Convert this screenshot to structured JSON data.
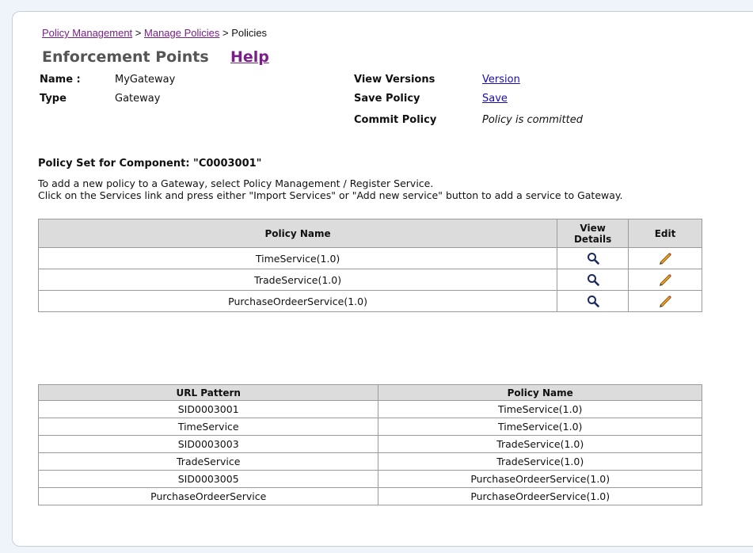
{
  "breadcrumb": {
    "items": [
      "Policy Management",
      "Manage Policies"
    ],
    "current": "Policies",
    "separator": ">"
  },
  "header": {
    "title": "Enforcement Points",
    "help_label": "Help"
  },
  "info": {
    "name_label": "Name :",
    "name_value": "MyGateway",
    "type_label": "Type",
    "type_value": "Gateway",
    "view_versions_label": "View Versions",
    "view_versions_link": "Version",
    "save_policy_label": "Save Policy",
    "save_policy_link": "Save",
    "commit_policy_label": "Commit Policy",
    "commit_policy_status": "Policy is committed"
  },
  "policy_set": {
    "heading": "Policy Set for Component: \"C0003001\"",
    "instructions_line1": "To add a new policy to a Gateway, select Policy Management / Register Service.",
    "instructions_line2": "Click on the Services link and press either \"Import Services\" or \"Add new service\" button to add a service to Gateway."
  },
  "policy_table": {
    "headers": {
      "name": "Policy Name",
      "view_line1": "View",
      "view_line2": "Details",
      "edit": "Edit"
    },
    "rows": [
      {
        "name": "TimeService(1.0)",
        "view_icon": "magnifier-icon",
        "edit_icon": "pencil-icon"
      },
      {
        "name": "TradeService(1.0)",
        "view_icon": "magnifier-icon",
        "edit_icon": "pencil-icon"
      },
      {
        "name": "PurchaseOrdeerService(1.0)",
        "view_icon": "magnifier-icon",
        "edit_icon": "pencil-icon"
      }
    ]
  },
  "url_table": {
    "headers": {
      "url": "URL Pattern",
      "policy": "Policy Name"
    },
    "rows": [
      {
        "url": "SID0003001",
        "policy": "TimeService(1.0)"
      },
      {
        "url": "TimeService",
        "policy": "TimeService(1.0)"
      },
      {
        "url": "SID0003003",
        "policy": "TradeService(1.0)"
      },
      {
        "url": "TradeService",
        "policy": "TradeService(1.0)"
      },
      {
        "url": "SID0003005",
        "policy": "PurchaseOrdeerService(1.0)"
      },
      {
        "url": "PurchaseOrdeerService",
        "policy": "PurchaseOrdeerService(1.0)"
      }
    ]
  },
  "colors": {
    "link": "#1a0dab",
    "visited_link": "#7a1f8a",
    "header_bg": "#dcdcdc",
    "page_bg": "#eef4fa"
  }
}
